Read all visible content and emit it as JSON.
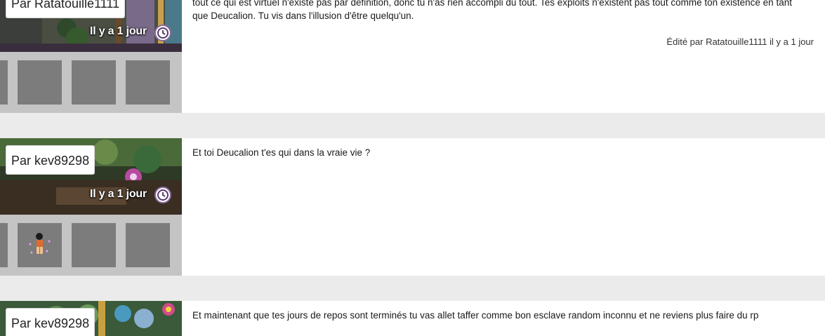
{
  "posts": [
    {
      "author": "Par Ratatouille1111",
      "time": "Il y a 1 jour",
      "body": "tout ce qui est virtuel n'existe pas par définition, donc tu n'as rien accompli du tout. Tes exploits n'existent pas tout comme ton existence en tant que Deucalion. Tu vis dans l'illusion d'être quelqu'un.",
      "edit_note": "Édité par Ratatouille1111 il y a 1 jour"
    },
    {
      "author": "Par kev89298",
      "time": "Il y a 1 jour",
      "body": "Et toi Deucalion t'es qui dans la vraie vie ?"
    },
    {
      "author": "Par kev89298",
      "time": "",
      "body": "Et maintenant que tes jours de repos sont terminés tu vas allet taffer comme bon esclave random inconnu et ne reviens plus faire du rp"
    }
  ],
  "icons": {
    "clock": "clock-icon",
    "badge": "badge-figure-icon"
  },
  "colors": {
    "separator": "#ebebeb",
    "badge_panel": "#c4c4c4",
    "badge_slot": "#7c7c7c"
  }
}
